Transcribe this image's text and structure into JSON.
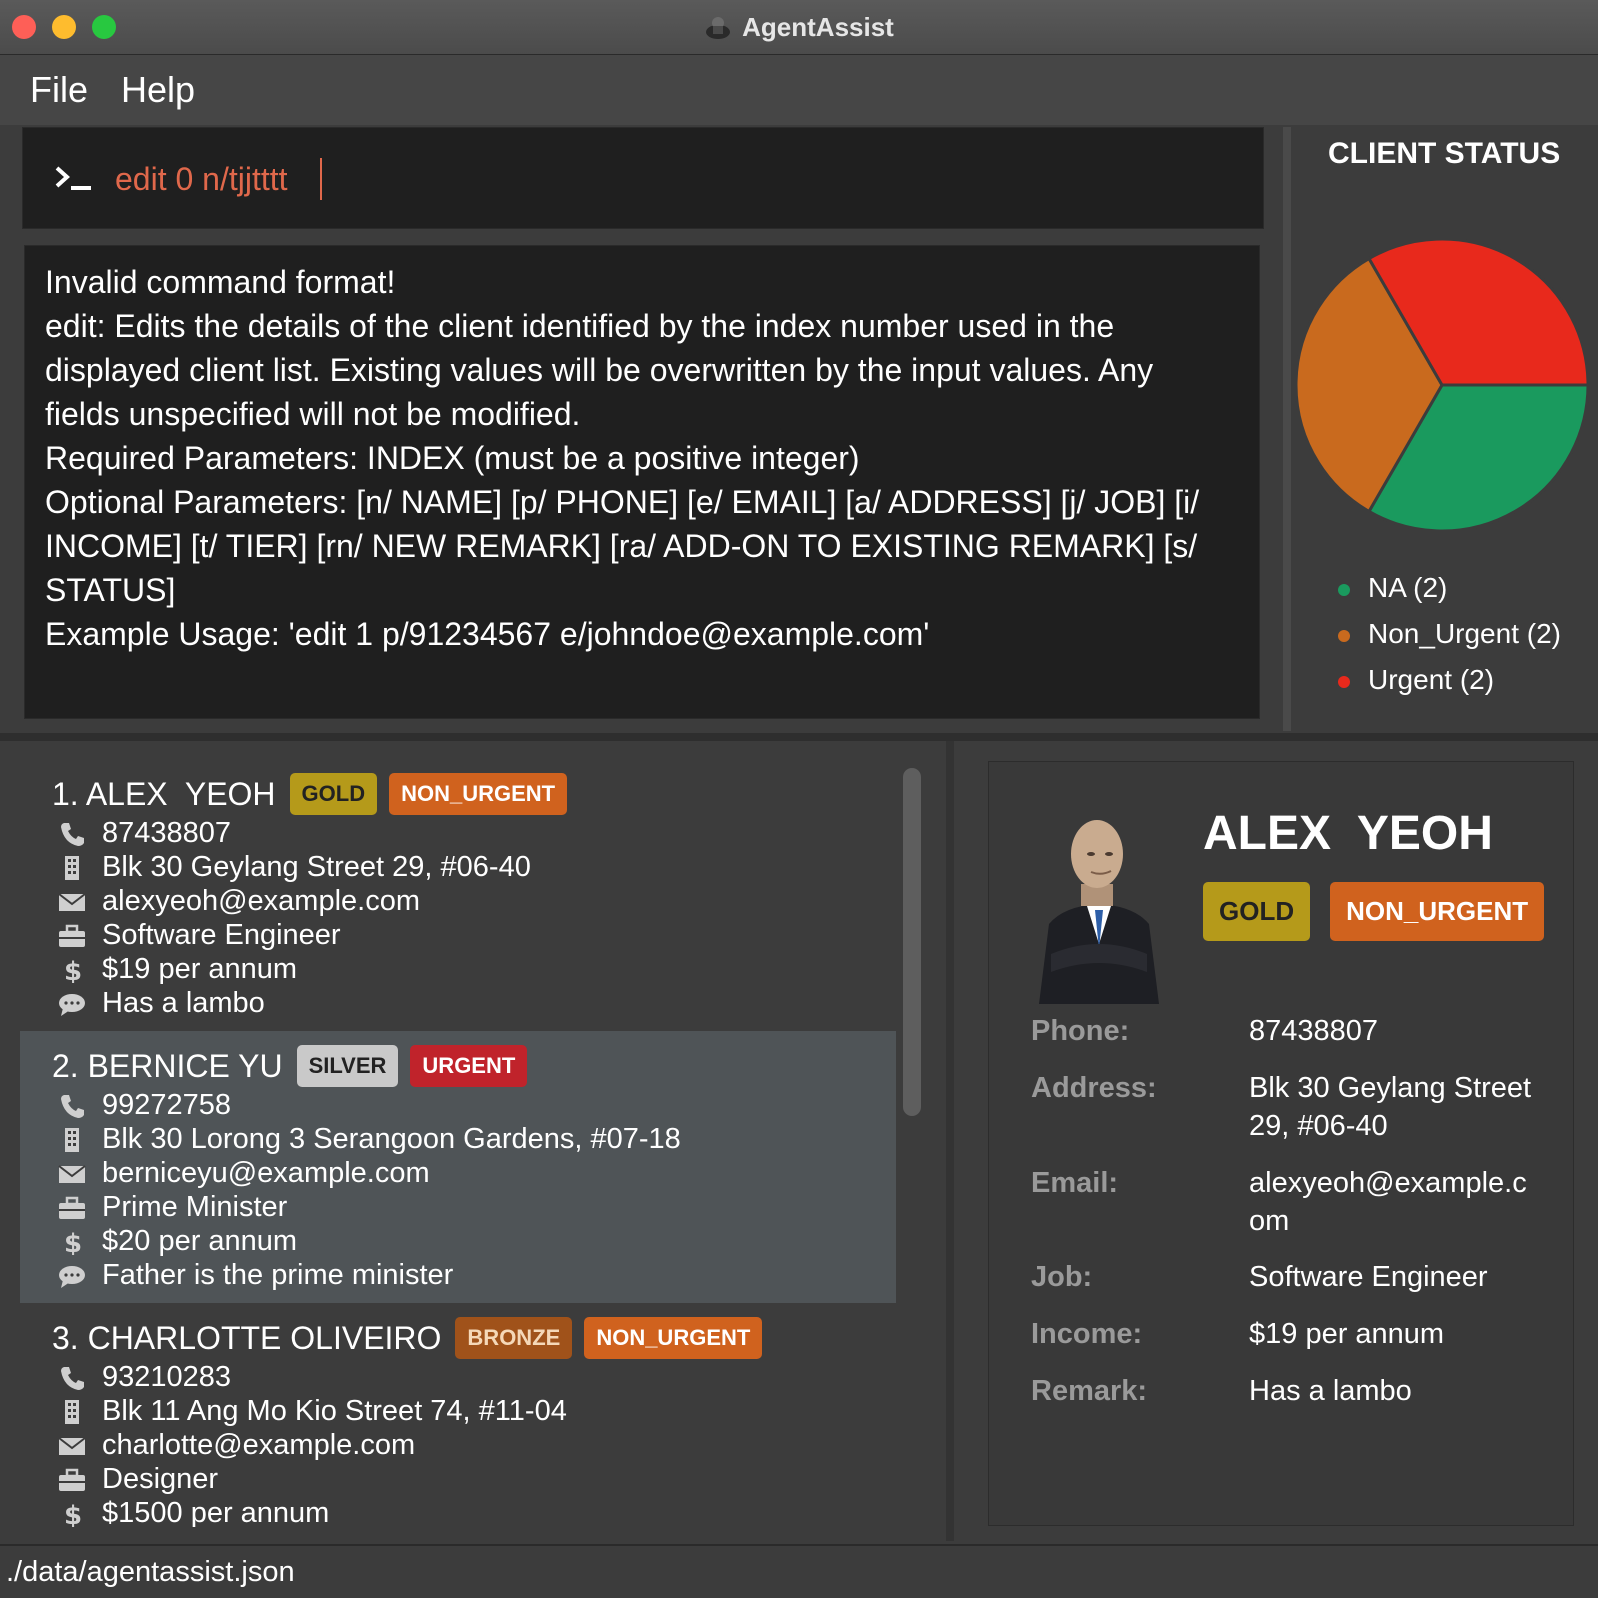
{
  "window": {
    "title": "AgentAssist"
  },
  "menu": {
    "file": "File",
    "help": "Help"
  },
  "command": {
    "value": "edit 0 n/tjjtttt"
  },
  "result": {
    "lines": [
      "Invalid command format!",
      "edit: Edits the details of the client identified by the index number used in the",
      "displayed client list. Existing values will be overwritten by the input values. Any",
      "fields unspecified will not be modified.",
      "Required Parameters: INDEX (must be a positive integer)",
      "Optional Parameters: [n/ NAME] [p/ PHONE] [e/ EMAIL] [a/ ADDRESS] [j/ JOB] [i/",
      "INCOME] [t/ TIER] [rn/ NEW REMARK] [ra/ ADD-ON TO EXISTING REMARK] [s/",
      "STATUS]",
      "Example Usage: 'edit 1 p/91234567 e/johndoe@example.com'"
    ]
  },
  "status_panel": {
    "title": "CLIENT STATUS",
    "legend": [
      {
        "label": "NA (2)",
        "color": "#1a9a5e"
      },
      {
        "label": "Non_Urgent (2)",
        "color": "#c96a1e"
      },
      {
        "label": "Urgent (2)",
        "color": "#e8291c"
      }
    ]
  },
  "chart_data": {
    "type": "pie",
    "title": "CLIENT STATUS",
    "categories": [
      "NA",
      "Non_Urgent",
      "Urgent"
    ],
    "values": [
      2,
      2,
      2
    ],
    "colors": [
      "#1a9a5e",
      "#c96a1e",
      "#e8291c"
    ],
    "legend": "bottom"
  },
  "clients": [
    {
      "header": "1. ALEX  YEOH",
      "tier": "GOLD",
      "tier_class": "tag-gold",
      "status": "NON_URGENT",
      "status_class": "tag-nonurgent",
      "phone": "87438807",
      "address": "Blk 30 Geylang Street 29, #06-40",
      "email": "alexyeoh@example.com",
      "job": "Software Engineer",
      "income": "$19 per annum",
      "remark": "Has a lambo"
    },
    {
      "header": "2. BERNICE YU",
      "tier": "SILVER",
      "tier_class": "tag-silver",
      "status": "URGENT",
      "status_class": "tag-urgent",
      "phone": "99272758",
      "address": "Blk 30 Lorong 3 Serangoon Gardens, #07-18",
      "email": "berniceyu@example.com",
      "job": "Prime Minister",
      "income": "$20 per annum",
      "remark": "Father is the prime minister"
    },
    {
      "header": "3. CHARLOTTE OLIVEIRO",
      "tier": "BRONZE",
      "tier_class": "tag-bronze",
      "status": "NON_URGENT",
      "status_class": "tag-nonurgent",
      "phone": "93210283",
      "address": "Blk 11 Ang Mo Kio Street 74, #11-04",
      "email": "charlotte@example.com",
      "job": "Designer",
      "income": "$1500 per annum",
      "remark": ""
    }
  ],
  "detail": {
    "name": "ALEX  YEOH",
    "tier": "GOLD",
    "status": "NON_URGENT",
    "labels": {
      "phone": "Phone:",
      "address": "Address:",
      "email": "Email:",
      "job": "Job:",
      "income": "Income:",
      "remark": "Remark:"
    },
    "phone": "87438807",
    "address_line1": "Blk 30 Geylang Street",
    "address_line2": "29, #06-40",
    "email_line1": "alexyeoh@example.c",
    "email_line2": "om",
    "job": "Software Engineer",
    "income": "$19 per annum",
    "remark": "Has a lambo"
  },
  "statusbar": {
    "path": "./data/agentassist.json"
  }
}
